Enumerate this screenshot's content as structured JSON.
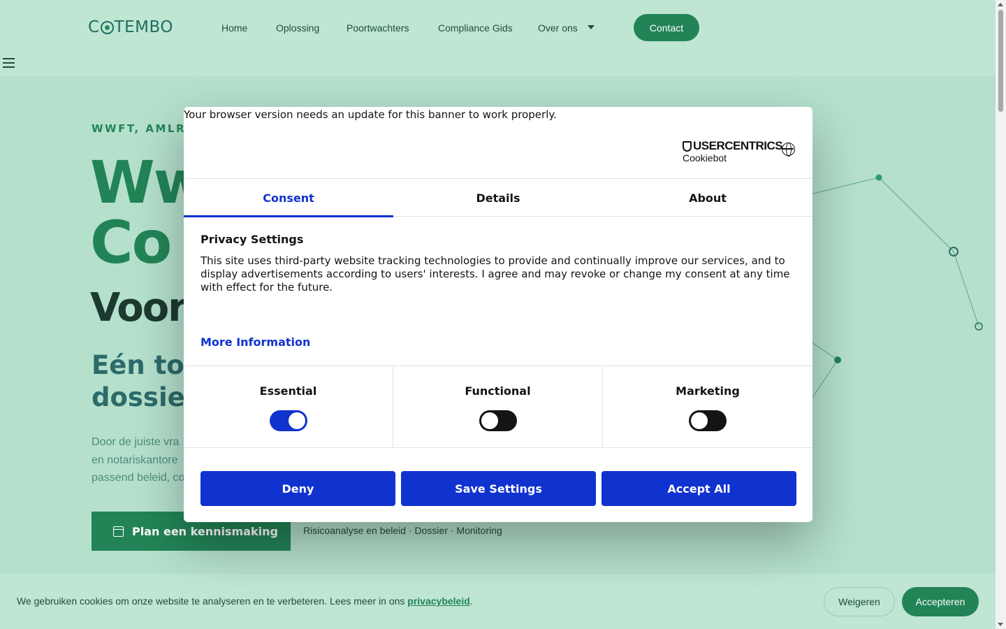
{
  "header": {
    "logo": "COTEMBO",
    "nav": [
      "Home",
      "Oplossing",
      "Poortwachters",
      "Compliance Gids",
      "Over ons"
    ],
    "contact_label": "Contact"
  },
  "hero": {
    "eyebrow": "WWFT, AMLR,",
    "title_line1": "Ww",
    "title_line2": "Co",
    "title_line3": "Voor",
    "subtitle_line1": "Eén tot",
    "subtitle_line2": "dossier",
    "para_line1": "Door de juiste vra",
    "para_line2": "en notariskantore",
    "para_line3": "passend beleid, co",
    "cta_label": "Plan een kennismaking",
    "features": "Risicoanalyse en beleid · Dossier · Monitoring"
  },
  "dialog": {
    "browser_warning": "Your browser version needs an update for this banner to work properly.",
    "brand_top": "USERCENTRICS",
    "brand_bottom": "Cookiebot",
    "tabs": [
      "Consent",
      "Details",
      "About"
    ],
    "privacy_title": "Privacy Settings",
    "privacy_body": "This site uses third-party website tracking technologies to provide and continually improve our services, and to display advertisements according to users' interests. I agree and may revoke or change my consent at any time with effect for the future.",
    "more_info": "More Information",
    "toggles": [
      {
        "label": "Essential",
        "on": true
      },
      {
        "label": "Functional",
        "on": false
      },
      {
        "label": "Marketing",
        "on": false
      }
    ],
    "buttons": [
      "Deny",
      "Save Settings",
      "Accept All"
    ]
  },
  "cookie_bar": {
    "text": "We gebruiken cookies om onze website te analyseren en te verbeteren. Lees meer in ons",
    "link": "privacybeleid",
    "end": ".",
    "weigeren": "Weigeren",
    "accepteren": "Accepteren"
  },
  "colors": {
    "brand_green": "#228456",
    "header_bg": "#bfe5d3",
    "page_bg": "#b4e0cc",
    "cookiebot_blue": "#1032cf"
  }
}
